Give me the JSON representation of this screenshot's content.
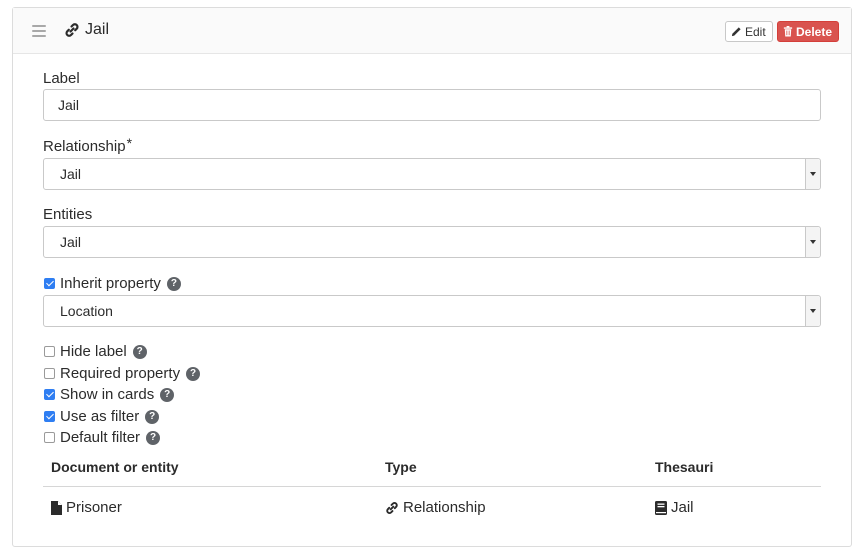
{
  "header": {
    "title": "Jail",
    "edit_label": "Edit",
    "delete_label": "Delete",
    "colors": {
      "delete_bg": "#d9534f"
    }
  },
  "form": {
    "label_field": {
      "label": "Label",
      "value": "Jail"
    },
    "relationship_field": {
      "label": "Relationship",
      "required_mark": "*",
      "value": "Jail"
    },
    "entities_field": {
      "label": "Entities",
      "value": "Jail"
    },
    "inherit_property": {
      "label": "Inherit property",
      "checked": true,
      "select_value": "Location"
    },
    "options": [
      {
        "label": "Hide label",
        "checked": false
      },
      {
        "label": "Required property",
        "checked": false
      },
      {
        "label": "Show in cards",
        "checked": true
      },
      {
        "label": "Use as filter",
        "checked": true
      },
      {
        "label": "Default filter",
        "checked": false
      }
    ]
  },
  "table": {
    "headers": [
      "Document or entity",
      "Type",
      "Thesauri"
    ],
    "rows": [
      {
        "entity": "Prisoner",
        "entity_icon": "file-icon",
        "type": "Relationship",
        "type_icon": "link-icon",
        "thesauri": "Jail",
        "thesauri_icon": "book-icon"
      }
    ]
  },
  "accent_color": "#2f7ef2"
}
